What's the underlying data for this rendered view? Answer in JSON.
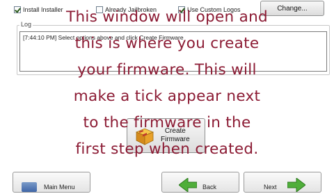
{
  "options": {
    "install_installer": {
      "label": "Install Installer",
      "checked": true
    },
    "already_jailbroken": {
      "label": "Already Jailbroken",
      "checked": false
    },
    "use_custom_logos": {
      "label": "Use Custom Logos",
      "checked": true
    },
    "change_label": "Change..."
  },
  "log": {
    "legend": "Log",
    "entry": "[7:44:10 PM] Select options above and click Create Firmware"
  },
  "create_button": {
    "line1": "Create",
    "line2": "Firmware"
  },
  "overlay_text": {
    "line1": "This window will open and",
    "line2": "this is where you create",
    "line3": "your firmware. This will",
    "line4": "make a tick appear next",
    "line5": "to the firmware in the",
    "line6": "first step when created."
  },
  "nav": {
    "main_menu_label": "Main Menu",
    "back_label": "Back",
    "next_label": "Next"
  },
  "colors": {
    "overlay_text": "#8b1a33",
    "window_bg": "#ffffff",
    "check_mark": "#2a5a1a"
  }
}
